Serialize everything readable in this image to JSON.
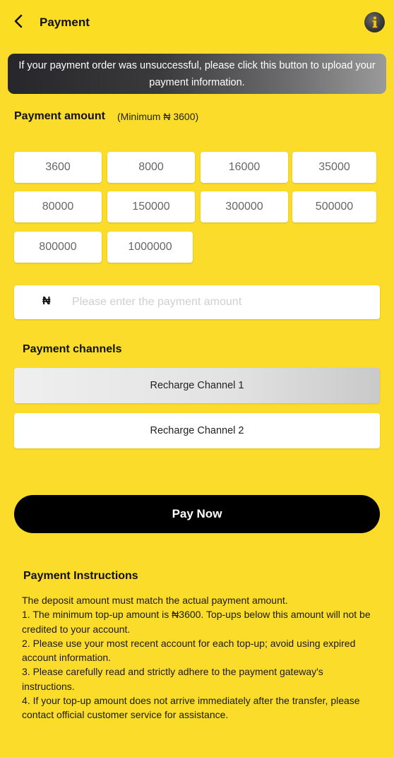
{
  "header": {
    "title": "Payment",
    "back_icon": "chevron-left-icon",
    "info_icon": "info-icon"
  },
  "notice": {
    "text": "If your payment order was unsuccessful, please click this button to upload your payment information."
  },
  "amount": {
    "label": "Payment amount",
    "minimum": "(Minimum ₦ 3600)",
    "options": [
      "3600",
      "8000",
      "16000",
      "35000",
      "80000",
      "150000",
      "300000",
      "500000",
      "800000",
      "1000000"
    ],
    "currency_symbol": "₦",
    "input_placeholder": "Please enter the payment amount",
    "input_value": ""
  },
  "channels": {
    "label": "Payment channels",
    "items": [
      {
        "label": "Recharge Channel 1",
        "selected": true
      },
      {
        "label": "Recharge Channel 2",
        "selected": false
      }
    ]
  },
  "pay_button": {
    "label": "Pay Now"
  },
  "instructions": {
    "title": "Payment Instructions",
    "lines": [
      "The deposit amount must match the actual payment amount.",
      "1. The minimum top-up amount is ₦3600. Top-ups below this amount will not be credited to your account.",
      "2. Please use your most recent account for each top-up; avoid using expired account information.",
      "3. Please carefully read and strictly adhere to the payment gateway's instructions.",
      "4. If your top-up amount does not arrive immediately after the transfer, please contact official customer service for assistance."
    ]
  },
  "colors": {
    "background": "#fbdc2a",
    "primary_button": "#000000",
    "card": "#ffffff"
  }
}
